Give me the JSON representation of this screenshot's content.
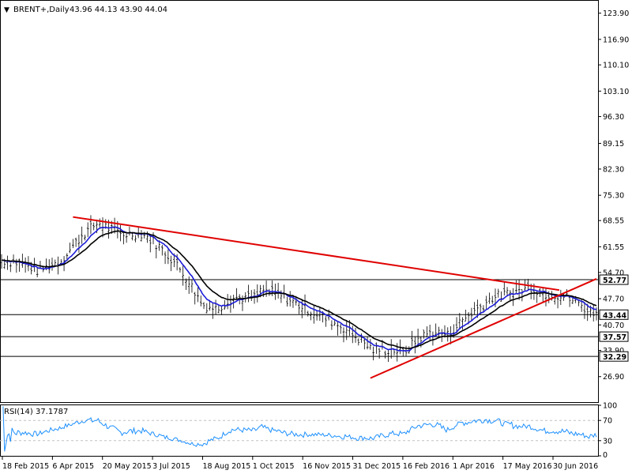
{
  "chart_data": [
    {
      "type": "ohlc",
      "header": {
        "marker": "▼",
        "symbol": "BRENT+,Daily",
        "quote": "43.96 44.13 43.90 44.04"
      },
      "y_ticks": [
        "123.90",
        "116.90",
        "110.10",
        "103.10",
        "96.30",
        "89.15",
        "82.30",
        "75.30",
        "68.55",
        "61.55",
        "54.70",
        "47.70",
        "40.70",
        "33.90",
        "26.90"
      ],
      "y_tick_values": [
        123.9,
        116.9,
        110.1,
        103.1,
        96.3,
        89.15,
        82.3,
        75.3,
        68.55,
        61.55,
        54.7,
        47.7,
        40.7,
        33.9,
        26.9
      ],
      "ylim": [
        20.1,
        127.2
      ],
      "x_ticks": [
        "18 Feb 2015",
        "6 Apr 2015",
        "20 May 2015",
        "3 Jul 2015",
        "18 Aug 2015",
        "1 Oct 2015",
        "16 Nov 2015",
        "31 Dec 2015",
        "16 Feb 2016",
        "1 Apr 2016",
        "17 May 2016",
        "30 Jun 2016"
      ],
      "horizontal_levels": [
        {
          "label": "52.77",
          "value": 52.77,
          "style": "boxed"
        },
        {
          "label": "43.44",
          "value": 43.44,
          "style": "highlight"
        },
        {
          "label": "37.57",
          "value": 37.57,
          "style": "boxed"
        },
        {
          "label": "32.29",
          "value": 32.29,
          "style": "boxed"
        }
      ],
      "trendlines": [
        {
          "name": "resistance",
          "color": "#e00000",
          "from": {
            "bar": 48,
            "price": 69.5
          },
          "to": {
            "bar": 375,
            "price": 50.0
          }
        },
        {
          "name": "support",
          "color": "#e00000",
          "from": {
            "bar": 248,
            "price": 26.5
          },
          "to": {
            "bar": 400,
            "price": 53.0
          }
        }
      ],
      "price_path": [
        [
          0,
          58
        ],
        [
          15,
          57
        ],
        [
          25,
          55
        ],
        [
          40,
          58
        ],
        [
          55,
          65
        ],
        [
          65,
          68
        ],
        [
          80,
          65
        ],
        [
          95,
          65
        ],
        [
          105,
          62
        ],
        [
          115,
          58
        ],
        [
          125,
          53
        ],
        [
          135,
          46
        ],
        [
          145,
          45
        ],
        [
          155,
          48
        ],
        [
          170,
          48
        ],
        [
          175,
          50
        ],
        [
          185,
          49
        ],
        [
          195,
          47
        ],
        [
          210,
          44
        ],
        [
          220,
          42
        ],
        [
          230,
          40
        ],
        [
          240,
          37
        ],
        [
          250,
          34
        ],
        [
          258,
          34
        ],
        [
          265,
          34
        ],
        [
          270,
          33
        ],
        [
          280,
          37
        ],
        [
          290,
          39
        ],
        [
          300,
          38
        ],
        [
          310,
          42
        ],
        [
          320,
          45
        ],
        [
          330,
          48
        ],
        [
          340,
          49
        ],
        [
          350,
          50
        ],
        [
          355,
          51
        ],
        [
          360,
          50
        ],
        [
          365,
          49
        ],
        [
          370,
          49
        ],
        [
          380,
          48
        ],
        [
          390,
          46
        ],
        [
          395,
          44
        ],
        [
          400,
          44.04
        ]
      ],
      "indicators": [
        {
          "name": "EMA fast",
          "color": "#1c1cd8"
        },
        {
          "name": "EMA slow",
          "color": "#000000"
        }
      ],
      "last_price": 44.04
    },
    {
      "type": "line",
      "header": {
        "label": "RSI(14) 37.1787"
      },
      "y_ticks": [
        "100",
        "70",
        "30",
        "0"
      ],
      "y_tick_values": [
        100,
        70,
        30,
        0
      ],
      "ylim": [
        0,
        100
      ],
      "levels": [
        70,
        30
      ],
      "series_color": "#1e90ff",
      "last_value": 37.18
    }
  ],
  "colors": {
    "candles": "#000000",
    "grid_dashed": "#c0c0c0",
    "trendline": "#e00000",
    "label_highlight_bg": "#ffffff"
  }
}
